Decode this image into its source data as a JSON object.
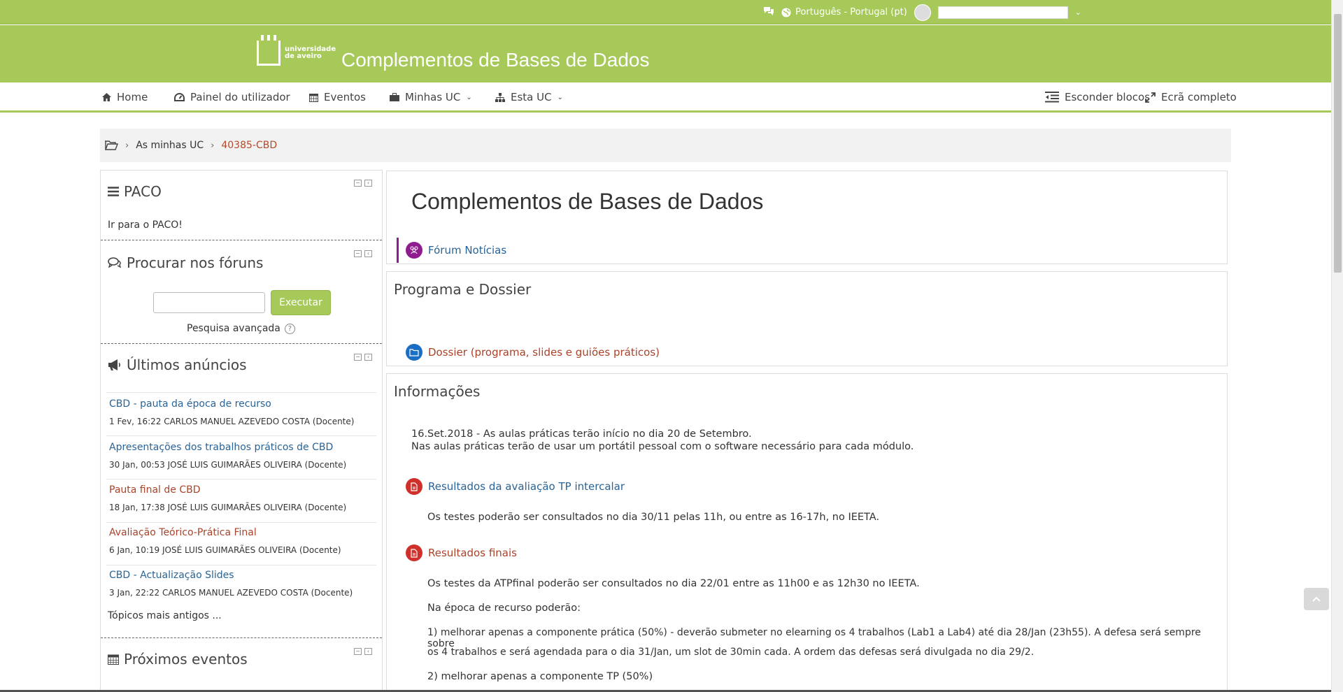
{
  "topbar": {
    "language": "Português - Portugal (pt)",
    "username": ""
  },
  "header": {
    "logo_line1": "universidade",
    "logo_line2": "de aveiro",
    "site_title": "Complementos de Bases de Dados"
  },
  "nav": {
    "home": "Home",
    "dashboard": "Painel do utilizador",
    "events": "Eventos",
    "my_courses": "Minhas UC",
    "this_course": "Esta UC",
    "hide_blocks": "Esconder blocos",
    "fullscreen": "Ecrã completo"
  },
  "breadcrumb": {
    "item1": "As minhas UC",
    "item2": "40385-CBD"
  },
  "blocks": {
    "paco": {
      "title": "PACO",
      "link": "Ir para o PACO!"
    },
    "forum_search": {
      "title": "Procurar nos fóruns",
      "button": "Executar",
      "advanced": "Pesquisa avançada",
      "help": "?"
    },
    "announcements": {
      "title": "Últimos anúncios",
      "items": [
        {
          "title": "CBD - pauta da época de recurso",
          "meta": "1 Fev, 16:22  CARLOS MANUEL AZEVEDO COSTA (Docente)"
        },
        {
          "title": "Apresentações dos trabalhos práticos de CBD",
          "meta": "30 Jan, 00:53  JOSÉ LUIS GUIMARÃES OLIVEIRA (Docente)"
        },
        {
          "title": "Pauta final de CBD",
          "meta": "18 Jan, 17:38  JOSÉ LUIS GUIMARÃES OLIVEIRA (Docente)"
        },
        {
          "title": "Avaliação Teórico-Prática Final",
          "meta": "6 Jan, 10:19  JOSÉ LUIS GUIMARÃES OLIVEIRA (Docente)"
        },
        {
          "title": "CBD - Actualização Slides",
          "meta": "3 Jan, 22:22  CARLOS MANUEL AZEVEDO COSTA (Docente)"
        }
      ],
      "older": "Tópicos mais antigos ..."
    },
    "events": {
      "title": "Próximos eventos"
    }
  },
  "main": {
    "course_title": "Complementos de Bases de Dados",
    "forum_news": "Fórum Notícias",
    "section1_title": "Programa e Dossier",
    "dossier": "Dossier (programa, slides e guiões práticos)",
    "section2_title": "Informações",
    "info_line1": "16.Set.2018 - As aulas práticas terão início no dia 20 de Setembro.",
    "info_line2": "Nas aulas práticas terão de usar um portátil pessoal com o software necessário para cada módulo.",
    "tp_results": "Resultados da avaliação TP intercalar",
    "tp_text": "Os testes poderão ser consultados no dia 30/11 pelas 11h, ou entre as 16-17h, no IEETA.",
    "final_results": "Resultados finais",
    "final_text1": "Os testes da ATPfinal poderão ser consultados no dia 22/01 entre as 11h00 e as 12h30 no IEETA.",
    "final_text2": "Na época de recurso poderão:",
    "final_text3a": "1) melhorar apenas a componente prática (50%) - deverão submeter no elearning os 4 trabalhos (Lab1 a Lab4) até dia 28/Jan (23h55). A defesa será sempre sobre",
    "final_text3b": "os 4 trabalhos e será agendada para o dia 31/Jan, um slot de 30min cada. A ordem das defesas será divulgada no dia 29/2.",
    "final_text4": "2) melhorar apenas a componente TP (50%)"
  },
  "colors": {
    "brand_green": "#a6c95a",
    "link_blue": "#2a6496",
    "link_red": "#a9432a",
    "forum_purple": "#8e1c8e",
    "folder_blue": "#1a6fc4",
    "pdf_red": "#d0302b"
  }
}
